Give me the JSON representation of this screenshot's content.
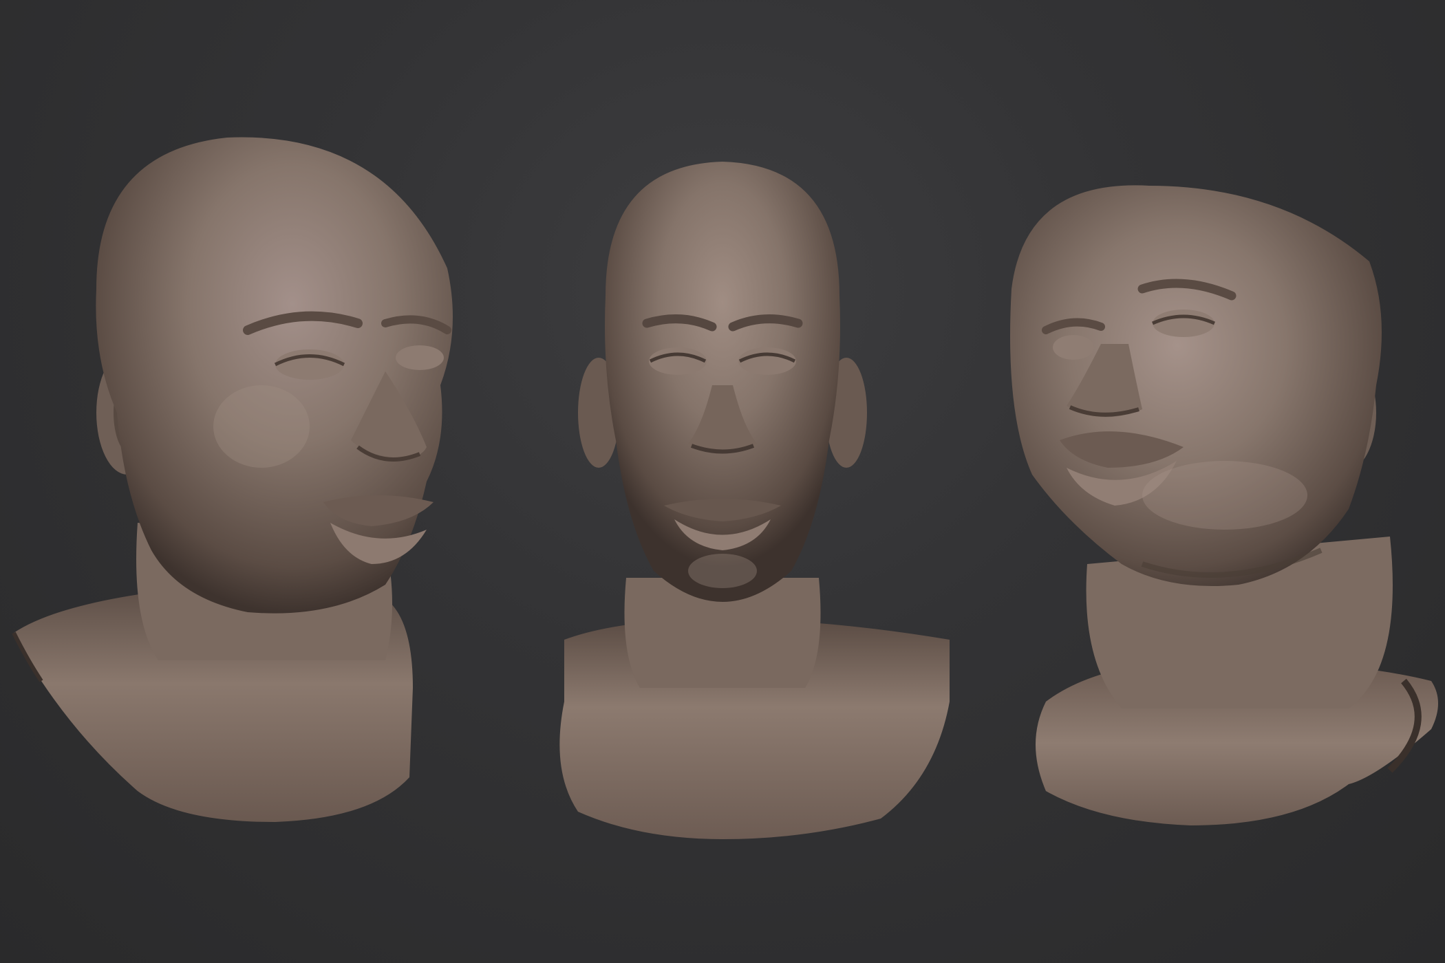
{
  "scene": {
    "background_color": "#313133",
    "clay_color": "#7d6d64",
    "clay_highlight": "#a89488",
    "clay_shadow": "#4a3e38"
  },
  "views": [
    {
      "name": "three-quarter-left",
      "icon": "sculpted-head-icon"
    },
    {
      "name": "front",
      "icon": "sculpted-head-icon"
    },
    {
      "name": "low-angle-right",
      "icon": "sculpted-head-icon"
    }
  ]
}
